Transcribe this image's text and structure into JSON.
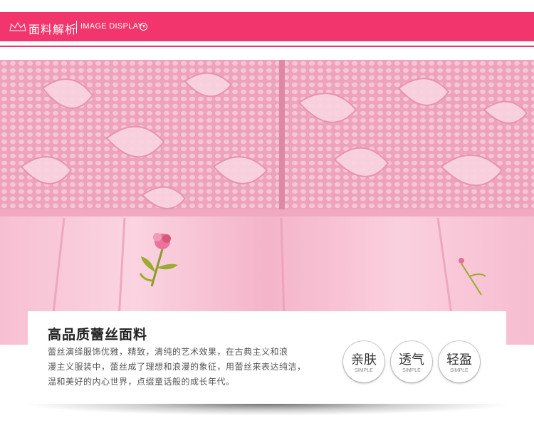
{
  "header": {
    "title_cn": "面料解析",
    "title_en": "IMAGE DISPLAY",
    "accent_color": "#f2356c",
    "icons": [
      "crown-icon",
      "chevron-down-circle-icon"
    ]
  },
  "product_photo": {
    "subject": "pink lace dress waist with embroidered rose appliqué"
  },
  "info": {
    "title": "高品质蕾丝面料",
    "desc_lines": [
      "蕾丝演绎服饰优雅，精致，清纯的艺术效果，在古典主义和浪",
      "漫主义服装中，蕾丝成了理想和浪漫的象征，用蕾丝来表达纯洁，",
      "温和美好的内心世界，点缀童话般的成长年代。"
    ]
  },
  "features": [
    {
      "label": "亲肤",
      "sub": "SIMPLE"
    },
    {
      "label": "透气",
      "sub": "SIMPLE"
    },
    {
      "label": "轻盈",
      "sub": "SIMPLE"
    }
  ]
}
